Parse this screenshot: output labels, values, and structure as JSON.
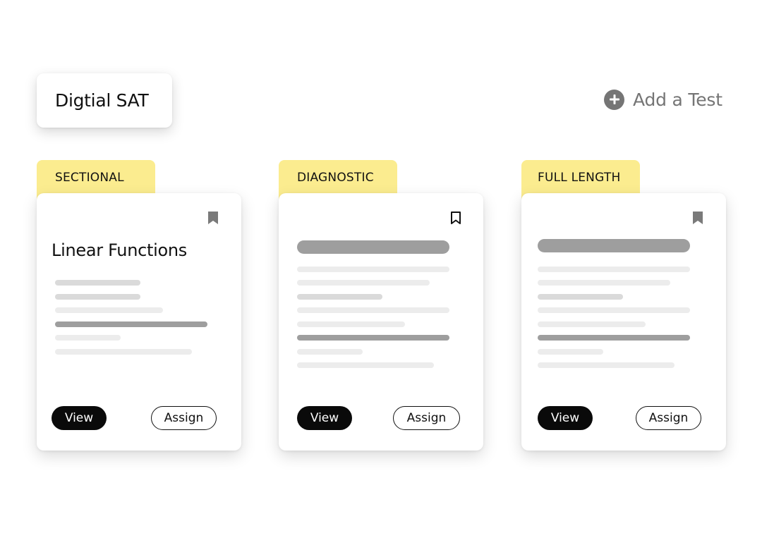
{
  "exam": {
    "title": "Digtial SAT"
  },
  "add_test": {
    "label": "Add a Test",
    "icon": "plus-circle-icon"
  },
  "colors": {
    "tag": "#fbec8f",
    "view_button": "#0a0a0a",
    "muted": "#757575"
  },
  "cards": [
    {
      "tag": "SECTIONAL",
      "title": "Linear Functions",
      "bookmark": "filled",
      "view_label": "View",
      "assign_label": "Assign"
    },
    {
      "tag": "DIAGNOSTIC",
      "title": "",
      "bookmark": "outline",
      "view_label": "View",
      "assign_label": "Assign"
    },
    {
      "tag": "FULL LENGTH",
      "title": "",
      "bookmark": "filled",
      "view_label": "View",
      "assign_label": "Assign"
    }
  ]
}
